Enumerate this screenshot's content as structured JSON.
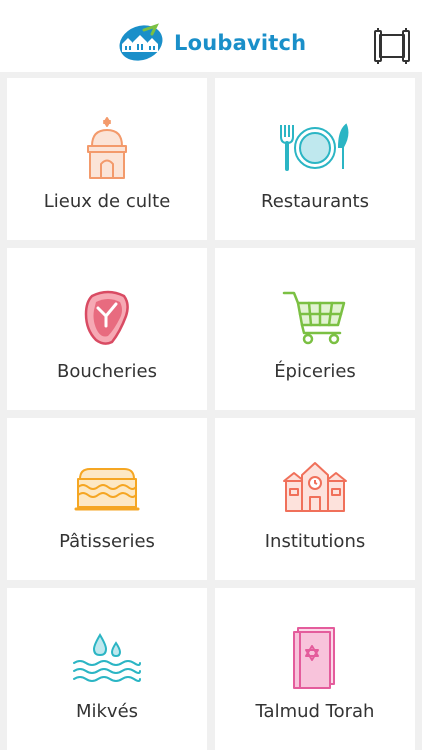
{
  "app": {
    "name": "Loubavitch",
    "logo_icon": "logo-houses-icon",
    "menu_icon": "scroll-menu-icon"
  },
  "colors": {
    "brand": "#1a8fc9",
    "background": "#f0f0f0",
    "tile": "#ffffff",
    "text": "#333333",
    "orange": "#f39a6b",
    "teal": "#2bb5c4",
    "crimson": "#d94b63",
    "green": "#7bc043",
    "pink": "#e45c9c"
  },
  "tiles": [
    {
      "label": "Lieux de culte",
      "icon": "synagogue-icon"
    },
    {
      "label": "Restaurants",
      "icon": "plate-cutlery-icon"
    },
    {
      "label": "Boucheries",
      "icon": "steak-icon"
    },
    {
      "label": "Épiceries",
      "icon": "shopping-cart-icon"
    },
    {
      "label": "Pâtisseries",
      "icon": "cake-icon"
    },
    {
      "label": "Institutions",
      "icon": "school-building-icon"
    },
    {
      "label": "Mikvés",
      "icon": "water-waves-icon"
    },
    {
      "label": "Talmud Torah",
      "icon": "torah-book-icon"
    }
  ]
}
